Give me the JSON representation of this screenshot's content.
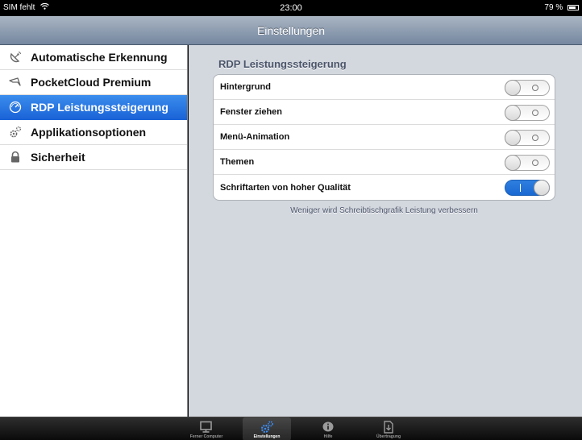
{
  "status": {
    "carrier": "SIM fehlt",
    "time": "23:00",
    "battery": "79 %",
    "battery_level": 0.79
  },
  "navbar": {
    "title": "Einstellungen"
  },
  "sidebar": {
    "items": [
      {
        "label": "Automatische Erkennung",
        "icon": "satellite-icon",
        "active": false
      },
      {
        "label": "PocketCloud Premium",
        "icon": "flag-icon",
        "active": false
      },
      {
        "label": "RDP Leistungssteigerung",
        "icon": "speedometer-icon",
        "active": true
      },
      {
        "label": "Applikationsoptionen",
        "icon": "gears-icon",
        "active": false
      },
      {
        "label": "Sicherheit",
        "icon": "lock-icon",
        "active": false
      }
    ]
  },
  "content": {
    "section_title": "RDP Leistungssteigerung",
    "rows": [
      {
        "label": "Hintergrund",
        "on": false
      },
      {
        "label": "Fenster ziehen",
        "on": false
      },
      {
        "label": "Menü-Animation",
        "on": false
      },
      {
        "label": "Themen",
        "on": false
      },
      {
        "label": "Schriftarten von hoher Qualität",
        "on": true
      }
    ],
    "hint": "Weniger wird Schreibtischgrafik Leistung verbessern"
  },
  "tabbar": {
    "tabs": [
      {
        "label": "Ferner Computer",
        "icon": "monitor-icon",
        "active": false
      },
      {
        "label": "Einstellungen",
        "icon": "gears-icon",
        "active": true
      },
      {
        "label": "Hilfe",
        "icon": "info-icon",
        "active": false
      },
      {
        "label": "Übertragung",
        "icon": "download-icon",
        "active": false
      }
    ]
  },
  "colors": {
    "accent": "#1a63d8",
    "content_bg": "#d3d7de",
    "navbar": "#7587a0"
  }
}
